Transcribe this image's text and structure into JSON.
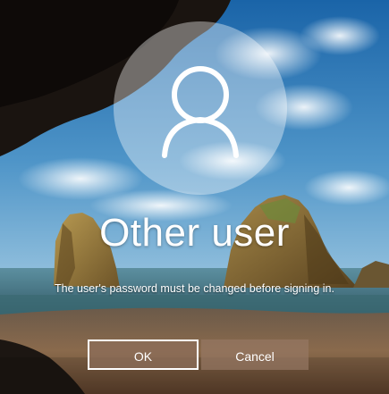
{
  "account": {
    "name": "Other user",
    "avatar_icon": "user-silhouette-icon"
  },
  "message": "The user's password must be changed before signing in.",
  "buttons": {
    "ok_label": "OK",
    "cancel_label": "Cancel"
  },
  "colors": {
    "text": "#ffffff",
    "sky_top": "#1f6fb3",
    "sky_bottom": "#7fb8dc",
    "sea": "#3f7c8a",
    "sand": "#7a5a40",
    "rock": "#9a7a3c"
  }
}
